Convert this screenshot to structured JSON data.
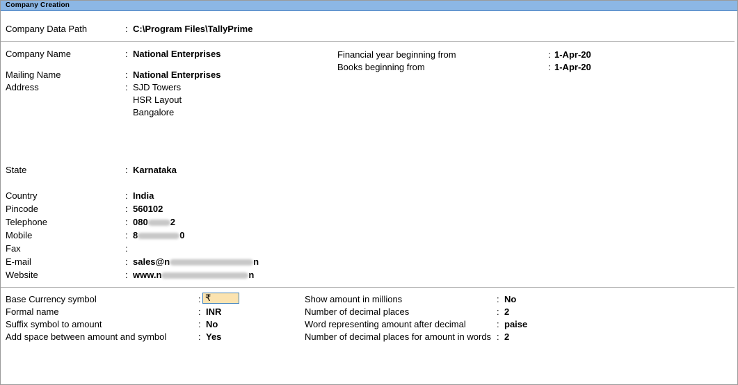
{
  "window": {
    "title": "Company Creation"
  },
  "data_path": {
    "label": "Company Data Path",
    "value": "C:\\Program Files\\TallyPrime"
  },
  "company": {
    "name_label": "Company Name",
    "name_value": "National Enterprises",
    "mailing_label": "Mailing Name",
    "mailing_value": "National Enterprises",
    "address_label": "Address",
    "address_lines": [
      "SJD Towers",
      "HSR Layout",
      "Bangalore"
    ],
    "state_label": "State",
    "state_value": "Karnataka",
    "country_label": "Country",
    "country_value": "India",
    "pincode_label": "Pincode",
    "pincode_value": "560102",
    "telephone_label": "Telephone",
    "telephone_prefix": "080",
    "telephone_suffix": "2",
    "mobile_label": "Mobile",
    "mobile_prefix": "8",
    "mobile_suffix": "0",
    "fax_label": "Fax",
    "email_label": "E-mail",
    "email_prefix": "sales@n",
    "email_suffix": "n",
    "website_label": "Website",
    "website_prefix": "www.n",
    "website_suffix": "n"
  },
  "financial": {
    "fy_label": "Financial year beginning from",
    "fy_value": "1-Apr-20",
    "books_label": "Books beginning from",
    "books_value": "1-Apr-20"
  },
  "currency": {
    "symbol_label": "Base Currency symbol",
    "symbol_value": "₹",
    "formal_label": "Formal name",
    "formal_value": "INR",
    "suffix_label": "Suffix symbol to amount",
    "suffix_value": "No",
    "space_label": "Add space between amount and symbol",
    "space_value": "Yes",
    "millions_label": "Show amount in millions",
    "millions_value": "No",
    "decimals_label": "Number of decimal places",
    "decimals_value": "2",
    "word_label": "Word representing amount after decimal",
    "word_value": "paise",
    "words_decimals_label": "Number of decimal places for amount in words",
    "words_decimals_value": "2"
  },
  "colon": ":"
}
